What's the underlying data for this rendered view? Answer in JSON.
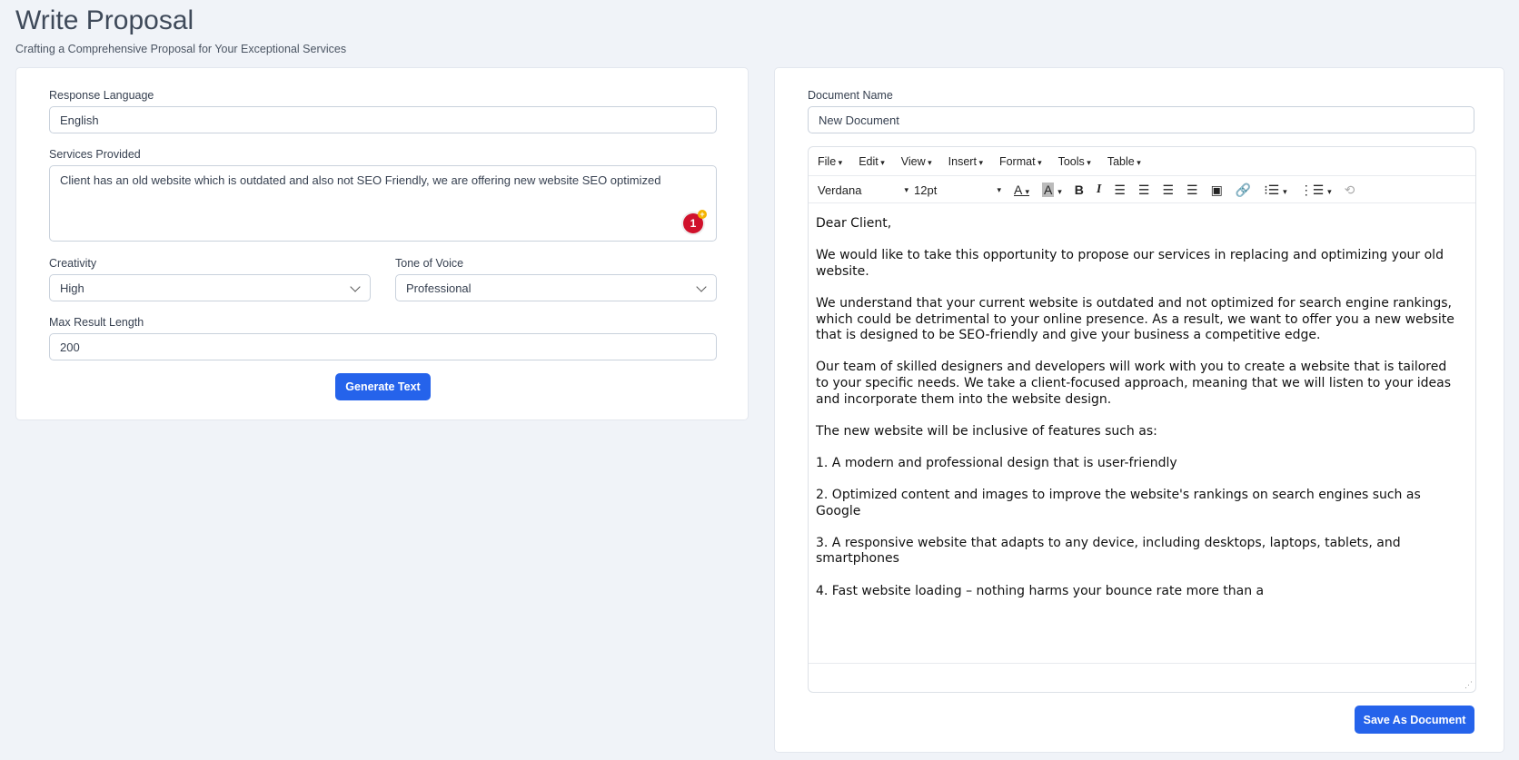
{
  "header": {
    "title": "Write Proposal",
    "subtitle": "Crafting a Comprehensive Proposal for Your Exceptional Services"
  },
  "form": {
    "response_language": {
      "label": "Response Language",
      "value": "English"
    },
    "services": {
      "label": "Services Provided",
      "value": "Client has an old website which is outdated and also not SEO Friendly, we are offering new website SEO optimized",
      "badge": "1"
    },
    "creativity": {
      "label": "Creativity",
      "value": "High"
    },
    "tone": {
      "label": "Tone of Voice",
      "value": "Professional"
    },
    "max_length": {
      "label": "Max Result Length",
      "value": "200"
    },
    "generate_label": "Generate Text"
  },
  "document": {
    "name_label": "Document Name",
    "name_value": "New Document",
    "menu": [
      "File",
      "Edit",
      "View",
      "Insert",
      "Format",
      "Tools",
      "Table"
    ],
    "font": "Verdana",
    "size": "12pt",
    "content": "Dear Client,\n\nWe would like to take this opportunity to propose our services in replacing and optimizing your old website.\n\nWe understand that your current website is outdated and not optimized for search engine rankings, which could be detrimental to your online presence. As a result, we want to offer you a new website that is designed to be SEO-friendly and give your business a competitive edge.\n\nOur team of skilled designers and developers will work with you to create a website that is tailored to your specific needs. We take a client-focused approach, meaning that we will listen to your ideas and incorporate them into the website design.\n\nThe new website will be inclusive of features such as:\n\n1. A modern and professional design that is user-friendly\n\n2. Optimized content and images to improve the website's rankings on search engines such as Google\n\n3. A responsive website that adapts to any device, including desktops, laptops, tablets, and smartphones\n\n4. Fast website loading – nothing harms your bounce rate more than a",
    "save_label": "Save As Document"
  },
  "colors": {
    "accent": "#2563eb",
    "background": "#f0f3f8",
    "badge": "#d0112b"
  }
}
